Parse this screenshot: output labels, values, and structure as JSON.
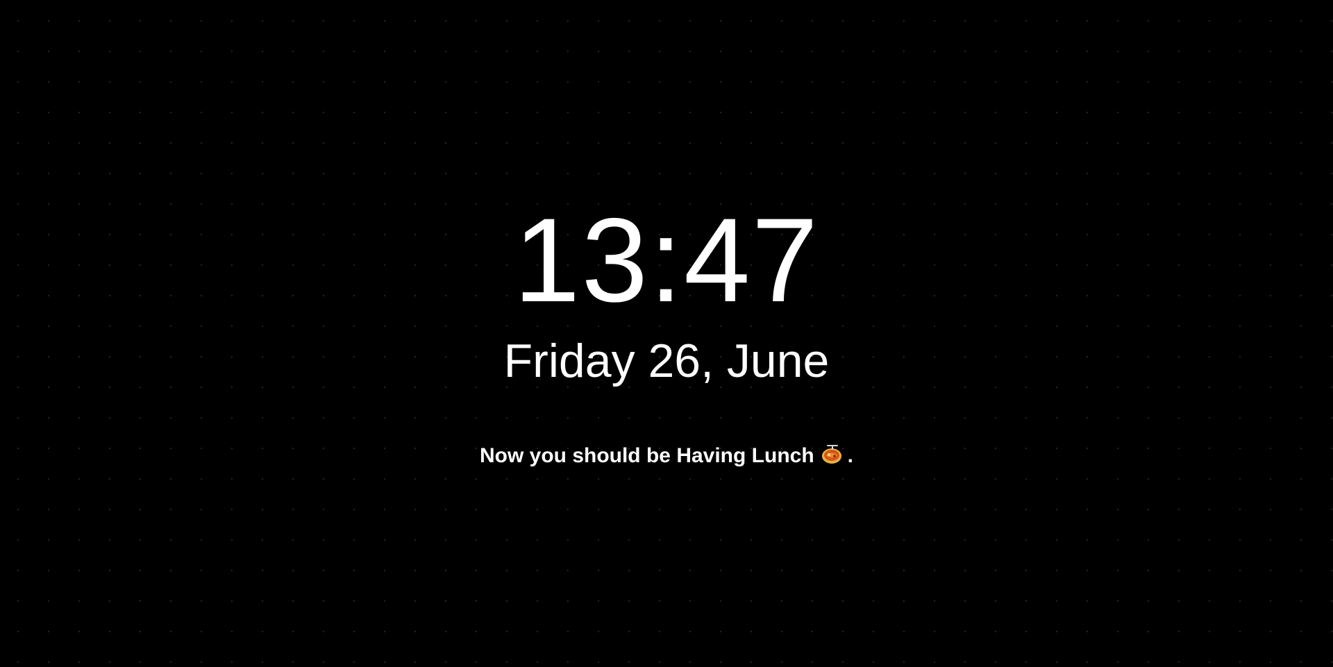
{
  "clock": {
    "time": "13:47",
    "date": "Friday 26, June"
  },
  "activity": {
    "prefix": "Now you should be Having Lunch",
    "icon": "lunch-food-icon",
    "suffix": "."
  },
  "colors": {
    "background": "#000000",
    "text": "#ffffff",
    "grid_dot": "#2a2a2a"
  }
}
